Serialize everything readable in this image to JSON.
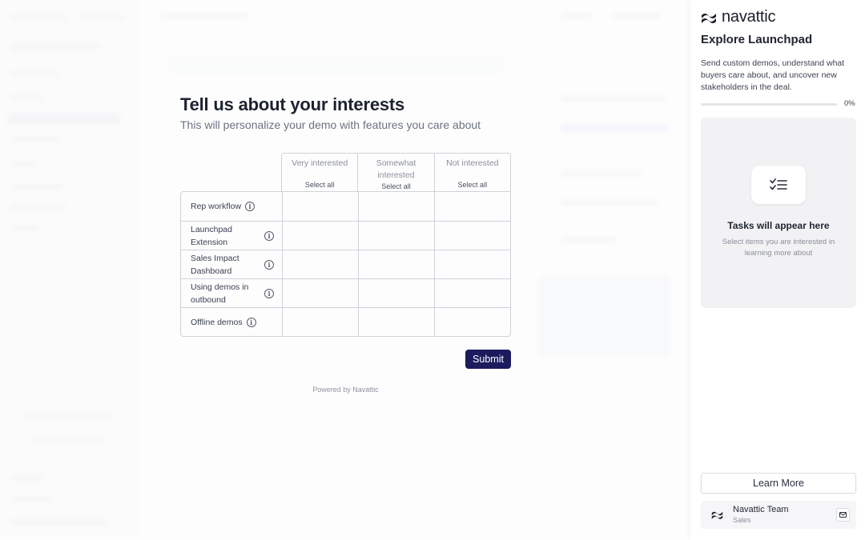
{
  "survey": {
    "title": "Tell us about your interests",
    "subtitle": "This will personalize your demo with features you care about",
    "columns": [
      {
        "label": "Very interested",
        "select_all": "Select all"
      },
      {
        "label": "Somewhat interested",
        "select_all": "Select all"
      },
      {
        "label": "Not interested",
        "select_all": "Select all"
      }
    ],
    "rows": [
      {
        "label": "Rep workflow"
      },
      {
        "label": "Launchpad Extension"
      },
      {
        "label": "Sales Impact Dashboard"
      },
      {
        "label": "Using demos in outbound"
      },
      {
        "label": "Offline demos"
      }
    ],
    "submit_label": "Submit",
    "powered_by": "Powered by Navattic"
  },
  "panel": {
    "brand": "navattic",
    "title": "Explore Launchpad",
    "description": "Send custom demos, understand what buyers care about, and uncover new stakeholders in the deal.",
    "progress_value": 0,
    "progress_label": "0%",
    "tasks_title": "Tasks will appear here",
    "tasks_subtitle": "Select items you are interested in learning more about",
    "learn_more_label": "Learn More",
    "contact": {
      "name": "Navattic Team",
      "role": "Sales"
    }
  },
  "colors": {
    "accent": "#1c1b5e",
    "border": "#cfd2d9",
    "panel_card": "#f2f2f4"
  },
  "icons": [
    "info-icon",
    "navattic-logo-icon",
    "checklist-icon",
    "mail-icon"
  ]
}
